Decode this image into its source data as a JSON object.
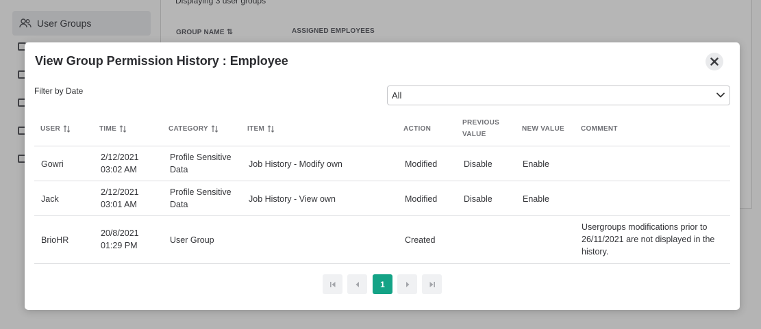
{
  "background": {
    "sidebar": {
      "active_item": "User Groups"
    },
    "caption": "Displaying 3 user groups",
    "columns": [
      "GROUP NAME",
      "ASSIGNED EMPLOYEES"
    ]
  },
  "modal": {
    "title": "View Group Permission History : Employee",
    "filter_label": "Filter by Date",
    "filter_value": "All",
    "columns": {
      "user": "USER",
      "time": "TIME",
      "category": "CATEGORY",
      "item": "ITEM",
      "action": "ACTION",
      "previous_value_1": "PREVIOUS",
      "previous_value_2": "VALUE",
      "new_value": "NEW VALUE",
      "comment": "COMMENT"
    },
    "rows": [
      {
        "user": "Gowri",
        "date": "2/12/2021",
        "time": "03:02 AM",
        "category_1": "Profile Sensitive",
        "category_2": "Data",
        "item": "Job History - Modify own",
        "action": "Modified",
        "previous": "Disable",
        "new": "Enable",
        "comment_1": "",
        "comment_2": "",
        "comment_3": ""
      },
      {
        "user": "Jack",
        "date": "2/12/2021",
        "time": "03:01 AM",
        "category_1": "Profile Sensitive",
        "category_2": "Data",
        "item": "Job History - View own",
        "action": "Modified",
        "previous": "Disable",
        "new": "Enable",
        "comment_1": "",
        "comment_2": "",
        "comment_3": ""
      },
      {
        "user": "BrioHR",
        "date": "20/8/2021",
        "time": "01:29 PM",
        "category_1": "User Group",
        "category_2": "",
        "item": "",
        "action": "Created",
        "previous": "",
        "new": "",
        "comment_1": "Usergroups modifications prior to",
        "comment_2": "26/11/2021 are not displayed in the",
        "comment_3": "history."
      }
    ],
    "pagination": {
      "current_page": "1"
    }
  },
  "colors": {
    "accent": "#14a386",
    "overlay": "#b4b4b4"
  }
}
